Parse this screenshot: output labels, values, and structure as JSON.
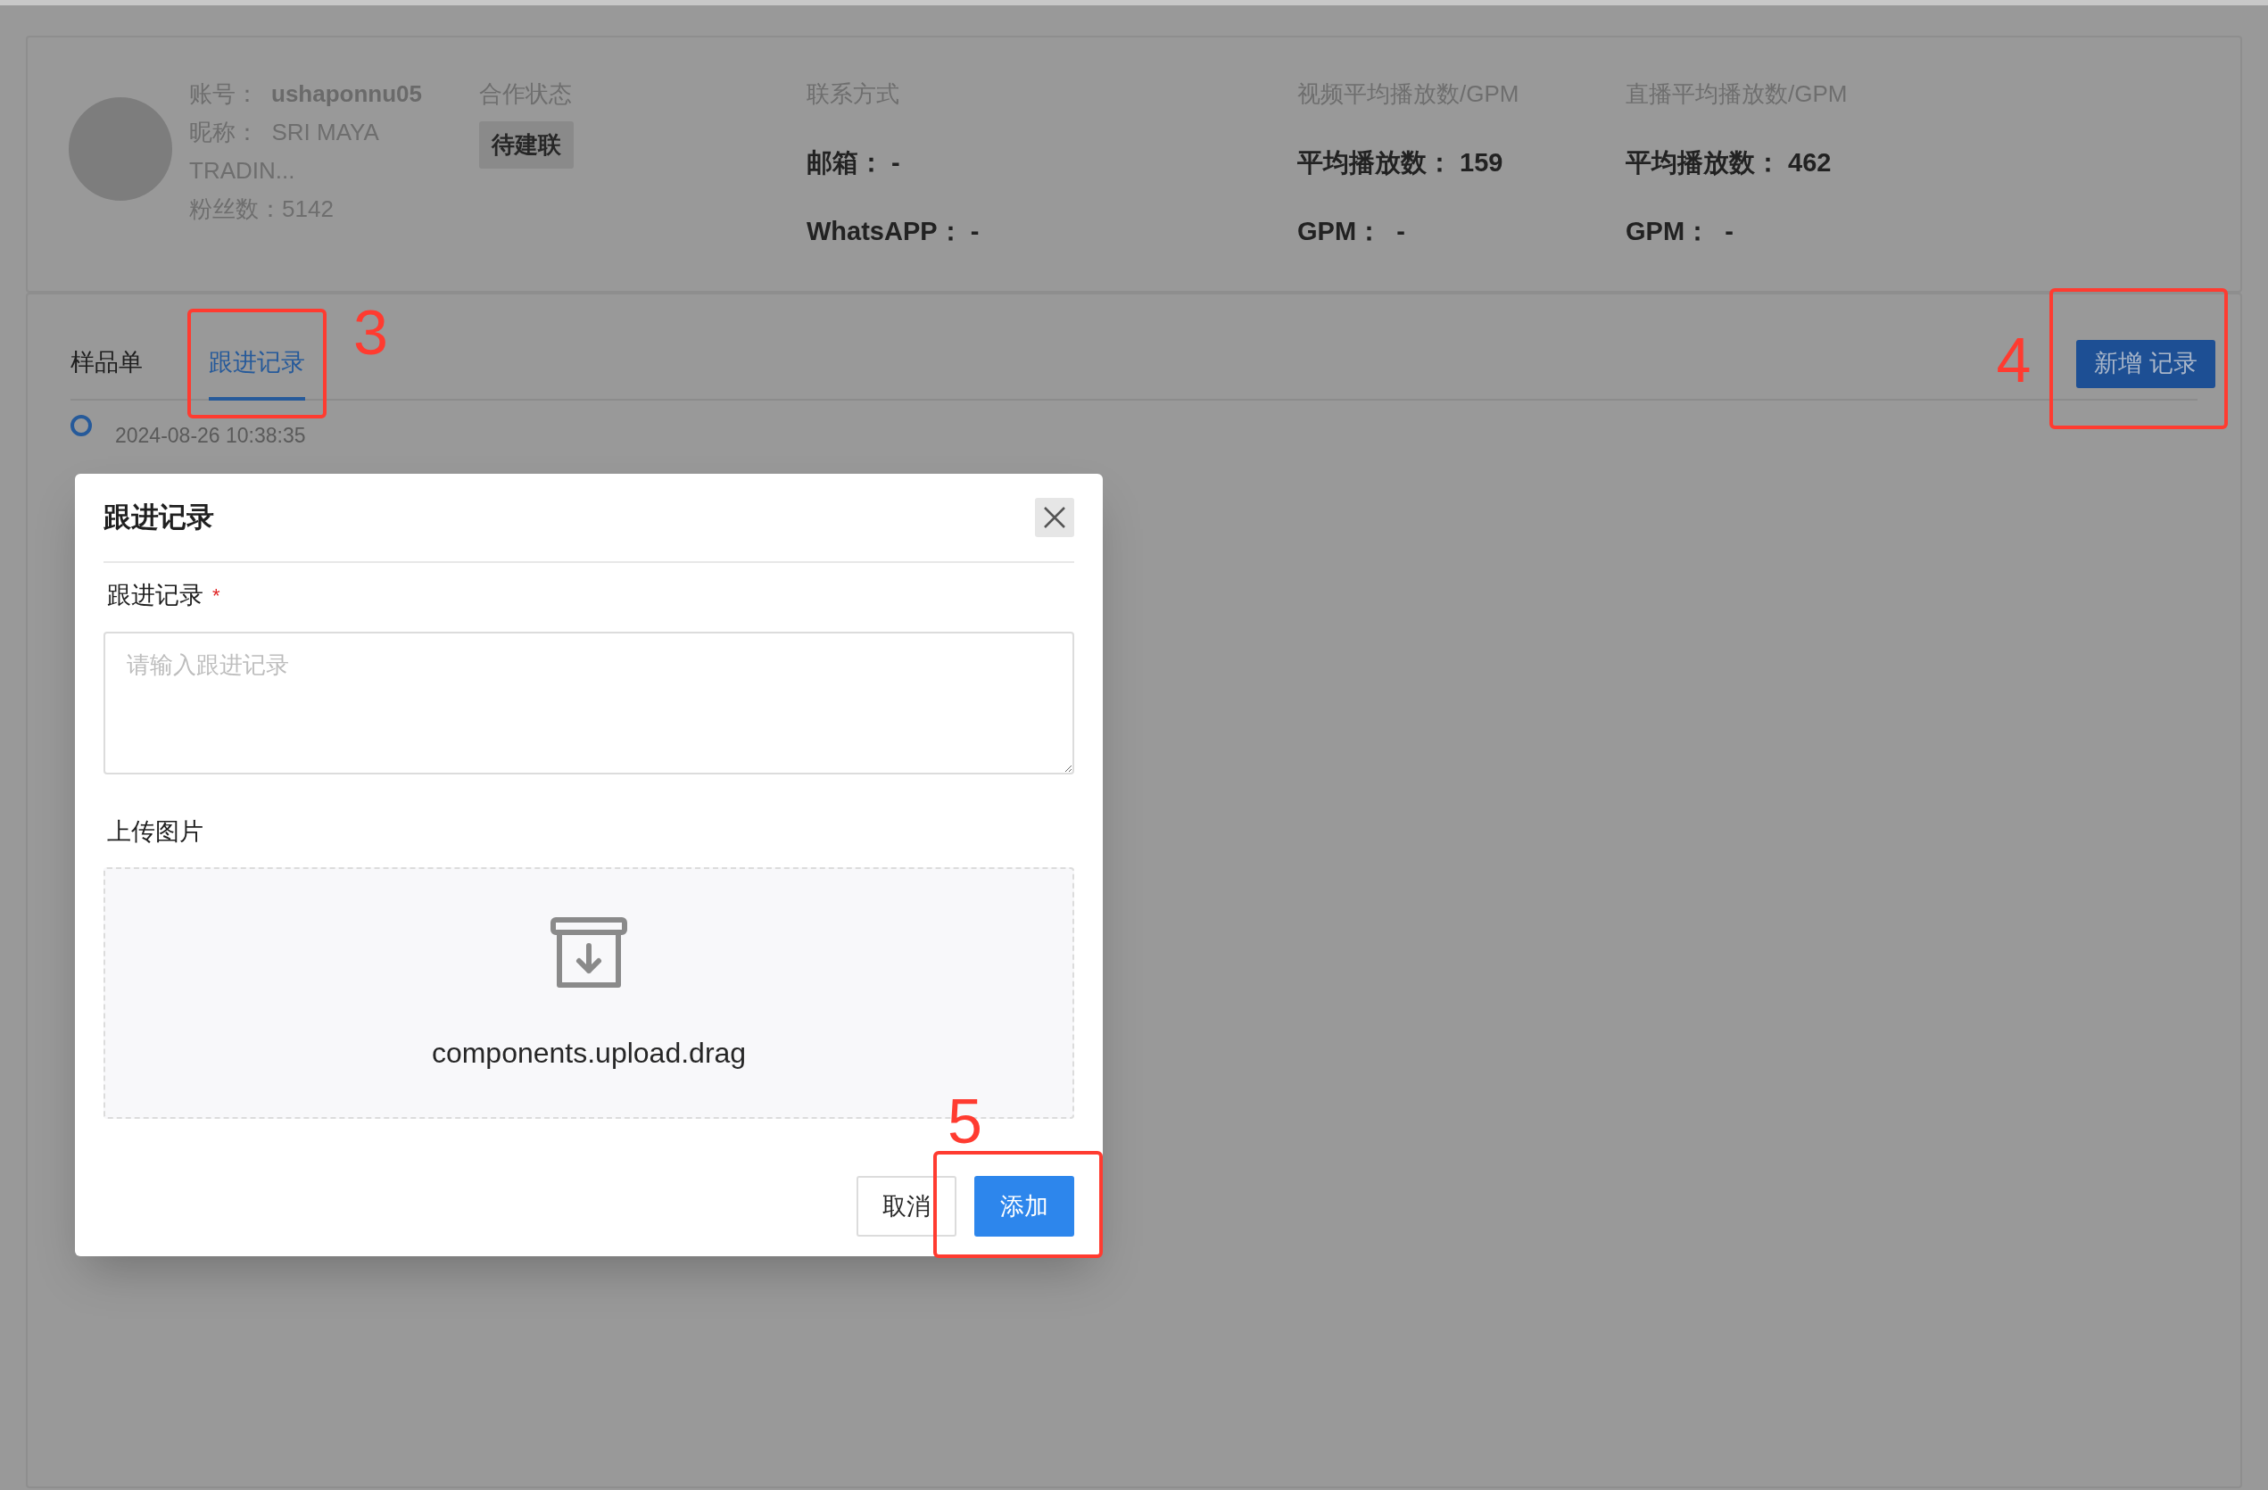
{
  "profile": {
    "account_label": "账号：",
    "account": "ushaponnu05",
    "nickname": "昵称：  SRI MAYA TRADIN...",
    "followers": "粉丝数：5142"
  },
  "cooperation": {
    "label": "合作状态",
    "status": "待建联"
  },
  "stat_columns": [
    {
      "label": "联系方式",
      "fields": [
        "邮箱： -",
        "WhatsAPP： -"
      ]
    },
    {
      "label": "视频平均播放数/GPM",
      "fields": [
        "平均播放数： 159",
        "GPM：  -"
      ]
    },
    {
      "label": "直播平均播放数/GPM",
      "fields": [
        "平均播放数： 462",
        "GPM：  -"
      ]
    }
  ],
  "tabs": [
    {
      "label": "样品单",
      "selected": false
    },
    {
      "label": "跟进记录",
      "selected": true
    }
  ],
  "tabs_annotation": "3",
  "add_button": {
    "label": "新增 记录",
    "annotation": "4"
  },
  "timeline": [
    {
      "time": "2024-08-26 10:38:35"
    }
  ],
  "modal": {
    "title": "跟进记录",
    "field_label": "跟进记录",
    "required_mark": "*",
    "placeholder": "请输入跟进记录",
    "upload_label": "上传图片",
    "upload_text": "components.upload.drag",
    "buttons": [
      {
        "label": "取消",
        "kind": "default"
      },
      {
        "label": "添加",
        "kind": "primary",
        "annotation": "5"
      }
    ]
  }
}
